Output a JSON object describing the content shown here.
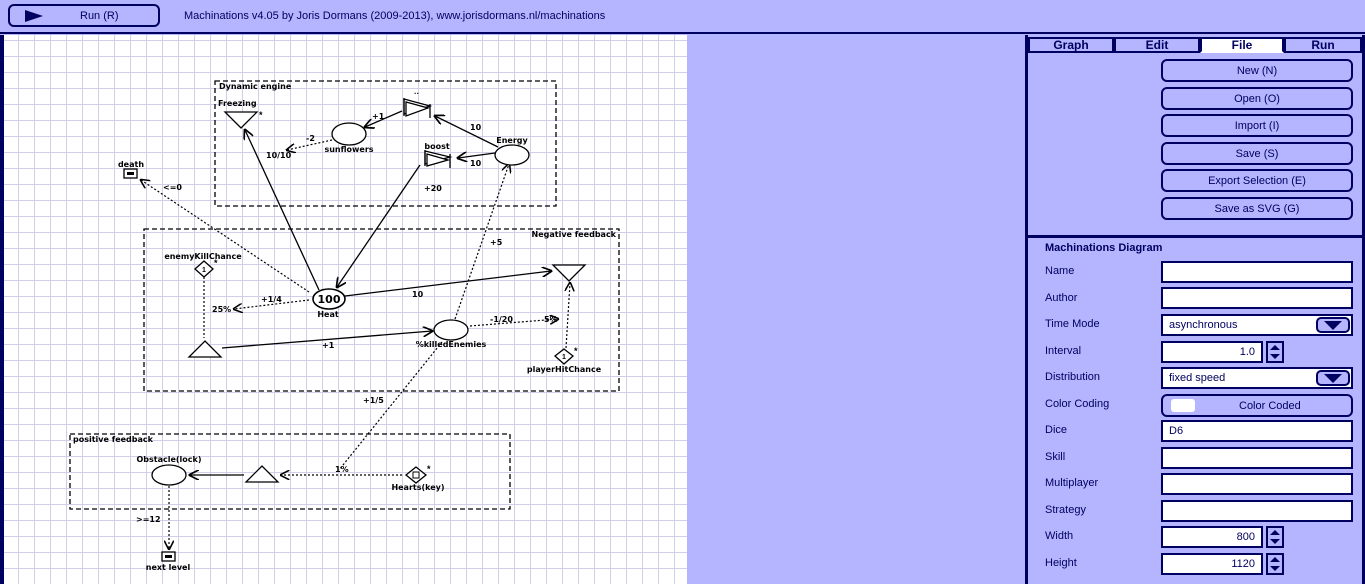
{
  "toolbar": {
    "run_label": "Run (R)",
    "app_title": "Machinations v4.05 by Joris Dormans (2009-2013), www.jorisdormans.nl/machinations"
  },
  "tabs": [
    "Graph",
    "Edit",
    "File",
    "Run"
  ],
  "active_tab": "File",
  "file_buttons": [
    "New (N)",
    "Open (O)",
    "Import (I)",
    "Save (S)",
    "Export Selection (E)",
    "Save as SVG (G)"
  ],
  "properties": {
    "section_title": "Machinations Diagram",
    "name_label": "Name",
    "name_value": "",
    "author_label": "Author",
    "author_value": "",
    "time_mode_label": "Time Mode",
    "time_mode_value": "asynchronous",
    "interval_label": "Interval",
    "interval_value": "1.0",
    "distribution_label": "Distribution",
    "distribution_value": "fixed speed",
    "color_coding_label": "Color Coding",
    "color_coding_value": "Color Coded",
    "dice_label": "Dice",
    "dice_value": "D6",
    "skill_label": "Skill",
    "skill_value": "",
    "multiplayer_label": "Multiplayer",
    "multiplayer_value": "",
    "strategy_label": "Strategy",
    "strategy_value": "",
    "width_label": "Width",
    "width_value": "800",
    "height_label": "Height",
    "height_value": "1120"
  },
  "diagram": {
    "groups": {
      "dynamic_engine": "Dynamic engine",
      "negative_feedback": "Negative feedback",
      "positive_feedback": "positive feedback"
    },
    "nodes": {
      "freezing": "Freezing",
      "sunflowers": "sunflowers",
      "energy": "Energy",
      "boost": "boost",
      "death": "death",
      "enemy_kill_chance": "enemyKillChance",
      "heat": "Heat",
      "heat_value": "100",
      "killed_enemies": "%killedEnemies",
      "player_hit_chance": "playerHitChance",
      "obstacle": "Obstacle(lock)",
      "hearts": "Hearts(key)",
      "next_level": "next level"
    },
    "labels": {
      "plus1_top": "+1",
      "minus2": "-2",
      "ten_ten": "10/10",
      "ten_a": "10",
      "ten_b": "10",
      "plus20": "+20",
      "le0": "<=0",
      "plus5": "+5",
      "plus1_4": "+1/4",
      "pct25": "25%",
      "ten_c": "10",
      "plus1_mid": "+1",
      "minus1_20": "-1/20",
      "pct5": "5%",
      "plus1_5": "+1/5",
      "pct1": "1%",
      "ge12": ">=12"
    }
  }
}
